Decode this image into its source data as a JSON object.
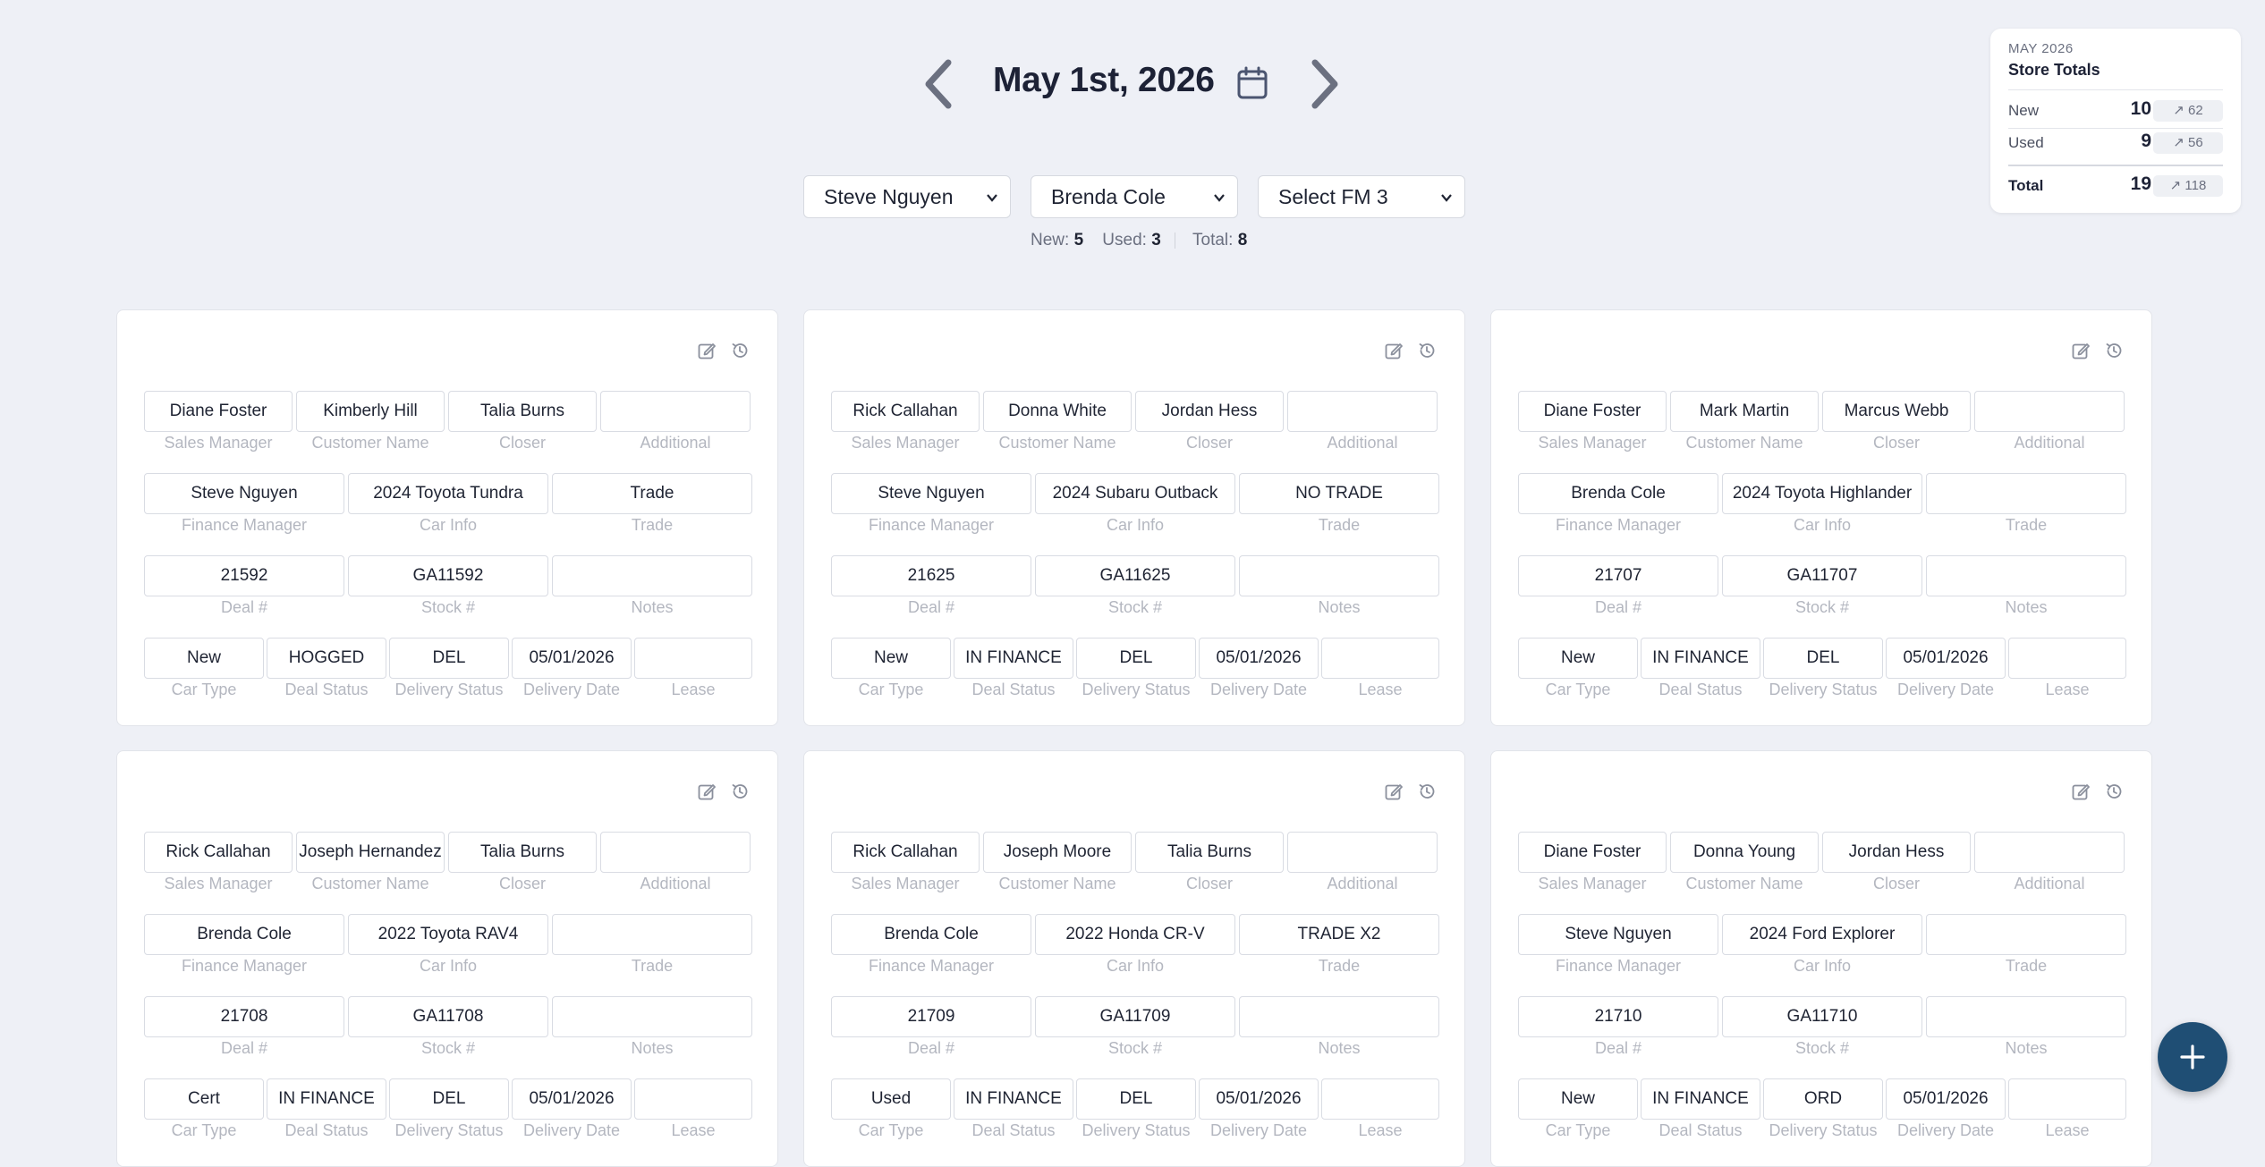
{
  "header": {
    "date_title": "May 1st, 2026",
    "prev_label": "previous-day",
    "next_label": "next-day"
  },
  "selects": [
    {
      "value": "Steve Nguyen"
    },
    {
      "value": "Brenda Cole"
    },
    {
      "value": "Select FM 3"
    }
  ],
  "fm_summary": {
    "new_label": "New:",
    "new_value": "5",
    "used_label": "Used:",
    "used_value": "3",
    "total_label": "Total:",
    "total_value": "8"
  },
  "store_totals": {
    "month": "MAY 2026",
    "title": "Store Totals",
    "rows": [
      {
        "label": "New",
        "value": "10",
        "trend": "↗ 62"
      },
      {
        "label": "Used",
        "value": "9",
        "trend": "↗ 56"
      },
      {
        "label": "Total",
        "value": "19",
        "trend": "↗ 118"
      }
    ]
  },
  "captions": {
    "sales_manager": "Sales Manager",
    "customer_name": "Customer Name",
    "closer": "Closer",
    "additional": "Additional",
    "finance_manager": "Finance Manager",
    "car_info": "Car Info",
    "trade": "Trade",
    "deal_no": "Deal #",
    "stock_no": "Stock #",
    "notes": "Notes",
    "car_type": "Car Type",
    "deal_status": "Deal Status",
    "delivery_status": "Delivery Status",
    "delivery_date": "Delivery Date",
    "lease": "Lease"
  },
  "deals": [
    {
      "sales_manager": "Diane Foster",
      "customer_name": "Kimberly Hill",
      "closer": "Talia Burns",
      "additional": "",
      "finance_manager": "Steve Nguyen",
      "car_info": "2024 Toyota Tundra",
      "trade": "Trade",
      "deal_no": "21592",
      "stock_no": "GA11592",
      "notes": "",
      "car_type": "New",
      "deal_status": "HOGGED",
      "delivery_status": "DEL",
      "delivery_date": "05/01/2026",
      "lease": ""
    },
    {
      "sales_manager": "Rick Callahan",
      "customer_name": "Donna White",
      "closer": "Jordan Hess",
      "additional": "",
      "finance_manager": "Steve Nguyen",
      "car_info": "2024 Subaru Outback",
      "trade": "NO TRADE",
      "deal_no": "21625",
      "stock_no": "GA11625",
      "notes": "",
      "car_type": "New",
      "deal_status": "IN FINANCE",
      "delivery_status": "DEL",
      "delivery_date": "05/01/2026",
      "lease": ""
    },
    {
      "sales_manager": "Diane Foster",
      "customer_name": "Mark Martin",
      "closer": "Marcus Webb",
      "additional": "",
      "finance_manager": "Brenda Cole",
      "car_info": "2024 Toyota Highlander",
      "trade": "",
      "deal_no": "21707",
      "stock_no": "GA11707",
      "notes": "",
      "car_type": "New",
      "deal_status": "IN FINANCE",
      "delivery_status": "DEL",
      "delivery_date": "05/01/2026",
      "lease": ""
    },
    {
      "sales_manager": "Rick Callahan",
      "customer_name": "Joseph Hernandez",
      "closer": "Talia Burns",
      "additional": "",
      "finance_manager": "Brenda Cole",
      "car_info": "2022 Toyota RAV4",
      "trade": "",
      "deal_no": "21708",
      "stock_no": "GA11708",
      "notes": "",
      "car_type": "Cert",
      "deal_status": "IN FINANCE",
      "delivery_status": "DEL",
      "delivery_date": "05/01/2026",
      "lease": ""
    },
    {
      "sales_manager": "Rick Callahan",
      "customer_name": "Joseph Moore",
      "closer": "Talia Burns",
      "additional": "",
      "finance_manager": "Brenda Cole",
      "car_info": "2022 Honda CR-V",
      "trade": "TRADE X2",
      "deal_no": "21709",
      "stock_no": "GA11709",
      "notes": "",
      "car_type": "Used",
      "deal_status": "IN FINANCE",
      "delivery_status": "DEL",
      "delivery_date": "05/01/2026",
      "lease": ""
    },
    {
      "sales_manager": "Diane Foster",
      "customer_name": "Donna Young",
      "closer": "Jordan Hess",
      "additional": "",
      "finance_manager": "Steve Nguyen",
      "car_info": "2024 Ford Explorer",
      "trade": "",
      "deal_no": "21710",
      "stock_no": "GA11710",
      "notes": "",
      "car_type": "New",
      "deal_status": "IN FINANCE",
      "delivery_status": "ORD",
      "delivery_date": "05/01/2026",
      "lease": ""
    }
  ],
  "colors": {
    "background": "#eef0f6",
    "fab": "#1f4e74",
    "icon_gray": "#8a8f9c"
  }
}
